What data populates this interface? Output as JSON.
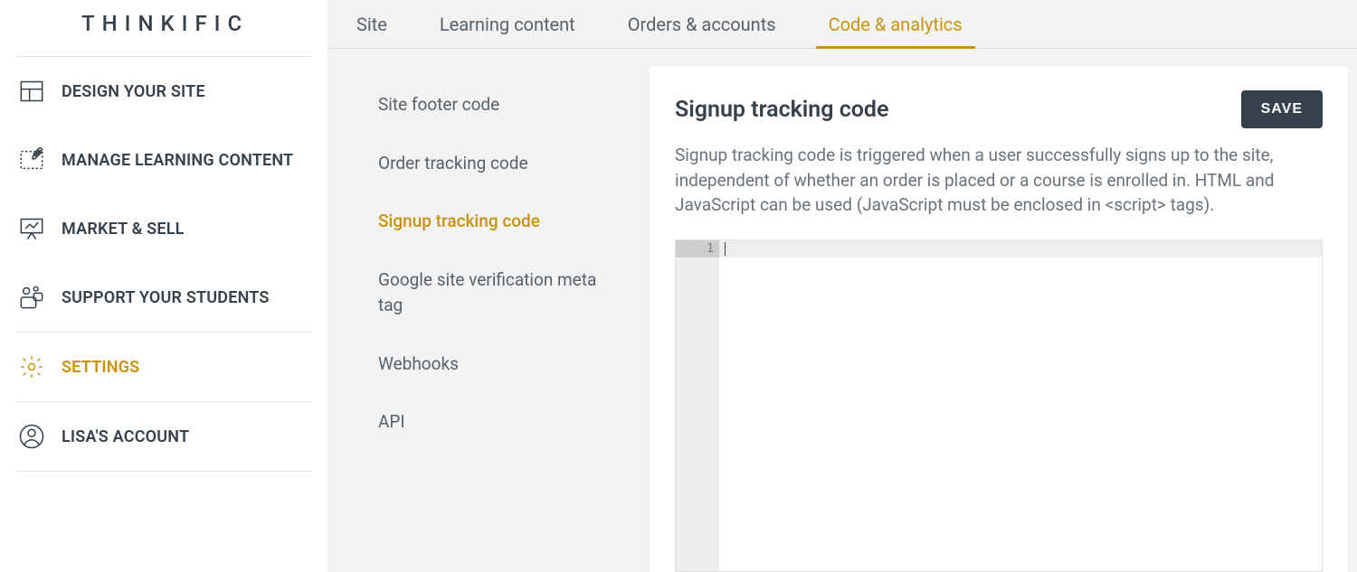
{
  "logo": "THINKIFIC",
  "sidebar": {
    "items": [
      {
        "label": "DESIGN YOUR SITE"
      },
      {
        "label": "MANAGE LEARNING CONTENT"
      },
      {
        "label": "MARKET & SELL"
      },
      {
        "label": "SUPPORT YOUR STUDENTS"
      },
      {
        "label": "SETTINGS"
      },
      {
        "label": "LISA'S ACCOUNT"
      }
    ]
  },
  "tabs": [
    {
      "label": "Site"
    },
    {
      "label": "Learning content"
    },
    {
      "label": "Orders & accounts"
    },
    {
      "label": "Code & analytics"
    }
  ],
  "sub_nav": [
    {
      "label": "Site footer code"
    },
    {
      "label": "Order tracking code"
    },
    {
      "label": "Signup tracking code"
    },
    {
      "label": "Google site verification meta tag"
    },
    {
      "label": "Webhooks"
    },
    {
      "label": "API"
    }
  ],
  "panel": {
    "title": "Signup tracking code",
    "save_label": "SAVE",
    "description": "Signup tracking code is triggered when a user successfully signs up to the site, independent of whether an order is placed or a course is enrolled in. HTML and JavaScript can be used (JavaScript must be enclosed in <script> tags)."
  },
  "editor": {
    "line_number": "1",
    "content": ""
  }
}
